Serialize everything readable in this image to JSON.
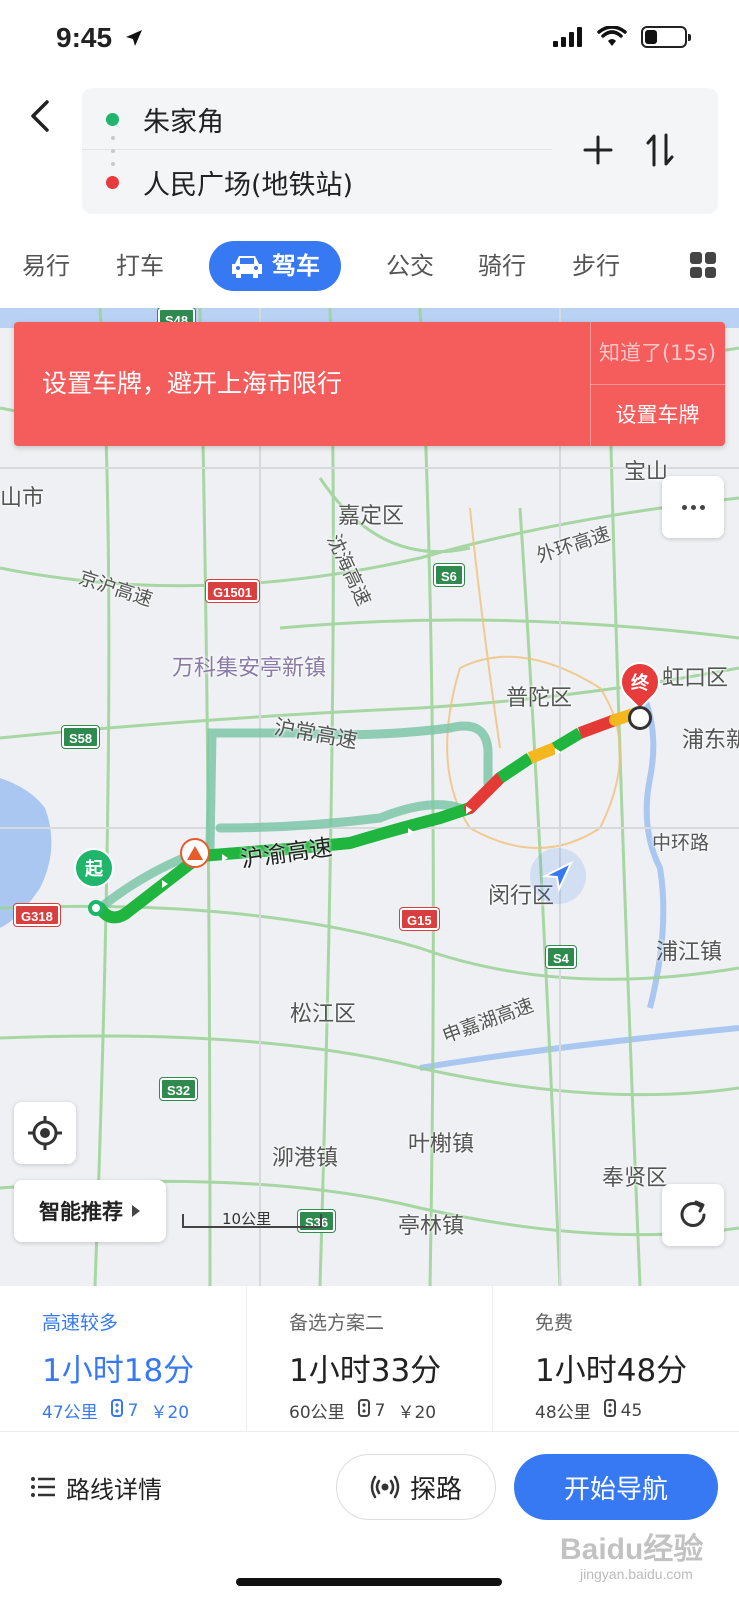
{
  "status_bar": {
    "time": "9:45"
  },
  "route": {
    "start": "朱家角",
    "end": "人民广场(地铁站)"
  },
  "mode_tabs": [
    {
      "label": "易行",
      "active": false
    },
    {
      "label": "打车",
      "active": false
    },
    {
      "label": "驾车",
      "active": true
    },
    {
      "label": "公交",
      "active": false
    },
    {
      "label": "骑行",
      "active": false
    },
    {
      "label": "步行",
      "active": false
    }
  ],
  "banner": {
    "message": "设置车牌，避开上海市限行",
    "dismiss": "知道了(15s)",
    "action": "设置车牌"
  },
  "map": {
    "labels": {
      "shan_shi": "山市",
      "jiading": "嘉定区",
      "huhai_highway": "沈海高速",
      "jinghu_highway": "京沪高速",
      "outer_ring": "外环高速",
      "baoshan": "宝山",
      "wanke": "万科集安亭新镇",
      "putuo": "普陀区",
      "hongkou": "虹口区",
      "pudong": "浦东新",
      "huchang": "沪常高速",
      "huyu": "沪渝高速",
      "zhonghuan": "中环路",
      "minhang": "闵行区",
      "pujiang": "浦江镇",
      "songjiang": "松江区",
      "zhongjiahu": "申嘉湖高速",
      "maogang": "泖港镇",
      "yexie": "叶榭镇",
      "fengxian": "奉贤区",
      "tinglin": "亭林镇",
      "scale": "10公里",
      "start_pin": "起",
      "end_pin": "终"
    },
    "shields": [
      "S48",
      "G1501",
      "S6",
      "S58",
      "G318",
      "G15",
      "S4",
      "S32",
      "S36"
    ],
    "smart_recommend": "智能推荐"
  },
  "route_options": [
    {
      "tag": "高速较多",
      "time": "1小时18分",
      "distance": "47公里",
      "lights": "7",
      "toll": "￥20",
      "selected": true
    },
    {
      "tag": "备选方案二",
      "time": "1小时33分",
      "distance": "60公里",
      "lights": "7",
      "toll": "￥20",
      "selected": false
    },
    {
      "tag": "免费",
      "time": "1小时48分",
      "distance": "48公里",
      "lights": "45",
      "toll": "",
      "selected": false
    }
  ],
  "actions": {
    "details": "路线详情",
    "explore": "探路",
    "navigate": "开始导航"
  },
  "watermark": {
    "main": "Baidu经验",
    "sub": "jingyan.baidu.com"
  },
  "colors": {
    "accent": "#3778f3",
    "banner": "#f55c5c",
    "route_green": "#1fb53e",
    "route_red": "#e53935",
    "route_yellow": "#f5b71e"
  }
}
